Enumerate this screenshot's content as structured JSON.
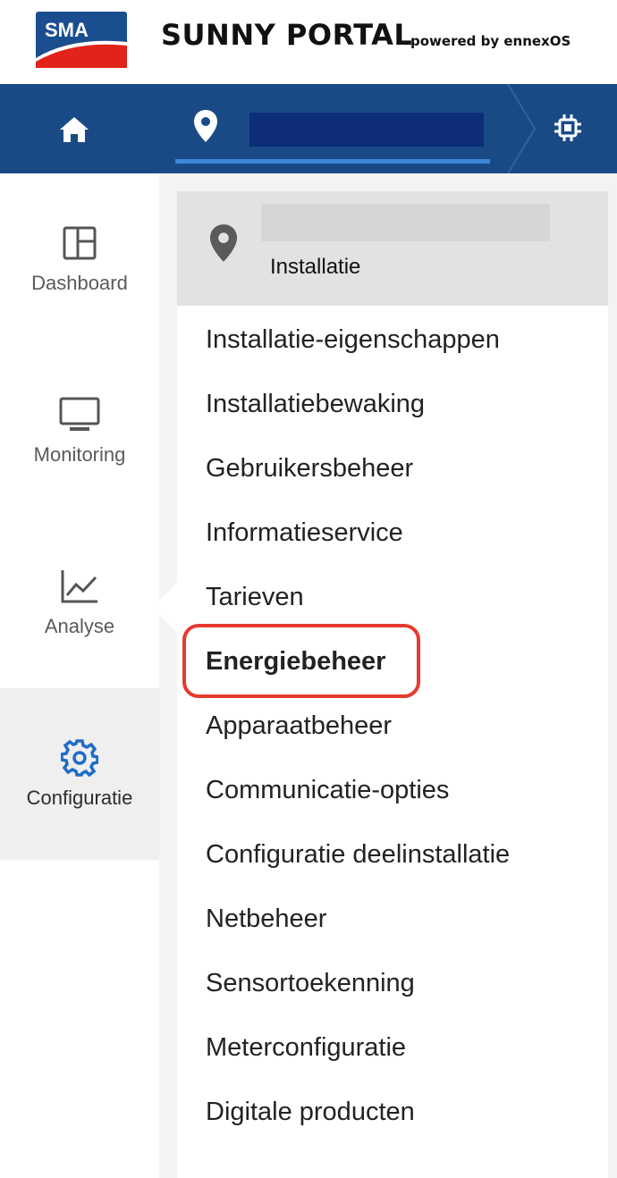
{
  "header": {
    "logo_text": "SMA",
    "title": "SUNNY PORTAL",
    "subtitle": "powered by ennexOS"
  },
  "navbar": {
    "home_icon": "home-icon",
    "location_icon": "location-pin-icon",
    "device_icon": "device-chip-icon"
  },
  "sidebar": {
    "items": [
      {
        "label": "Dashboard",
        "icon": "dashboard-icon",
        "active": false
      },
      {
        "label": "Monitoring",
        "icon": "monitor-icon",
        "active": false
      },
      {
        "label": "Analyse",
        "icon": "chart-line-icon",
        "active": false
      },
      {
        "label": "Configuratie",
        "icon": "gear-icon",
        "active": true
      }
    ]
  },
  "panel": {
    "title": "Installatie",
    "icon": "location-pin-icon",
    "items": [
      {
        "label": "Installatie-eigenschappen"
      },
      {
        "label": "Installatiebewaking"
      },
      {
        "label": "Gebruikersbeheer"
      },
      {
        "label": "Informatieservice"
      },
      {
        "label": "Tarieven"
      },
      {
        "label": "Energiebeheer",
        "highlighted": true
      },
      {
        "label": "Apparaatbeheer"
      },
      {
        "label": "Communicatie-opties"
      },
      {
        "label": "Configuratie deelinstallatie"
      },
      {
        "label": "Netbeheer"
      },
      {
        "label": "Sensortoekenning"
      },
      {
        "label": "Meterconfiguratie"
      },
      {
        "label": "Digitale producten"
      }
    ]
  },
  "colors": {
    "nav_bg": "#1a4a86",
    "nav_accent": "#3d87d8",
    "gear_accent": "#1f6cc7",
    "highlight": "#e53b2e"
  }
}
